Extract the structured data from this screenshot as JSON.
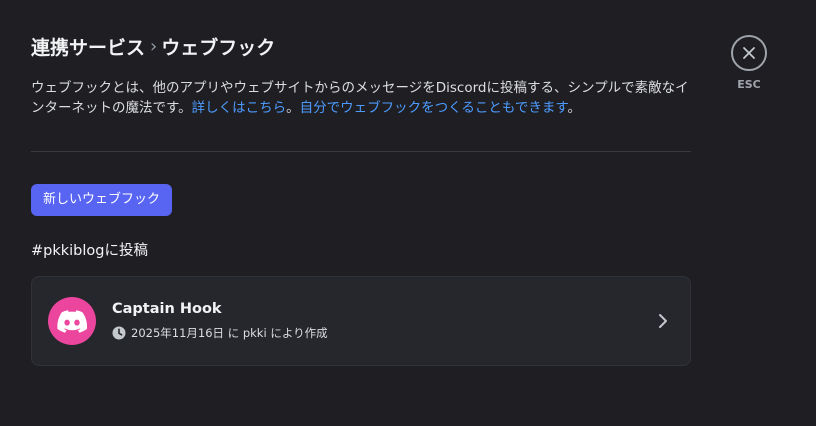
{
  "breadcrumb": {
    "parent": "連携サービス",
    "separator": "›",
    "current": "ウェブフック"
  },
  "description": {
    "text": "ウェブフックとは、他のアプリやウェブサイトからのメッセージをDiscordに投稿する、シンプルで素敵なインターネットの魔法です。",
    "link1": "詳しくはこちら",
    "mid": "。",
    "link2": "自分でウェブフックをつくることもできます",
    "end": "。"
  },
  "new_webhook_button": "新しいウェブフック",
  "channel_heading": "#pkkiblogに投稿",
  "webhooks": [
    {
      "name": "Captain Hook",
      "created": "2025年11月16日 に pkki により作成",
      "icon": "discord-icon",
      "avatar_color": "#eb459e"
    }
  ],
  "close": {
    "label": "ESC",
    "icon": "close-icon"
  },
  "colors": {
    "accent": "#5865f2",
    "link": "#4d9bff",
    "background": "#1f1f23"
  }
}
